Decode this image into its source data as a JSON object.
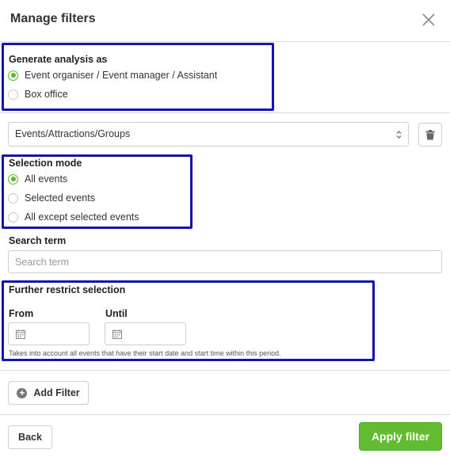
{
  "dialog": {
    "title": "Manage filters"
  },
  "generate_as": {
    "label": "Generate analysis as",
    "options": [
      {
        "label": "Event organiser / Event manager / Assistant",
        "selected": true
      },
      {
        "label": "Box office",
        "selected": false
      }
    ]
  },
  "dimension_select": {
    "value": "Events/Attractions/Groups"
  },
  "selection_mode": {
    "label": "Selection mode",
    "options": [
      {
        "label": "All events",
        "selected": true
      },
      {
        "label": "Selected events",
        "selected": false
      },
      {
        "label": "All except selected events",
        "selected": false
      }
    ]
  },
  "search": {
    "label": "Search term",
    "placeholder": "Search term",
    "value": ""
  },
  "restrict": {
    "label": "Further restrict selection",
    "from_label": "From",
    "until_label": "Until",
    "hint": "Takes into account all events that have their start date and start time within this period."
  },
  "actions": {
    "add_filter": "Add Filter",
    "back": "Back",
    "apply": "Apply filter"
  },
  "colors": {
    "accent_green": "#62bb30",
    "radio_green": "#5cb82e",
    "highlight_blue": "#1414b4"
  },
  "icons": {
    "close": "close-icon",
    "trash": "trash-icon",
    "calendar": "calendar-icon",
    "plus": "plus-circle-icon",
    "select_arrows": "select-arrows-icon"
  }
}
